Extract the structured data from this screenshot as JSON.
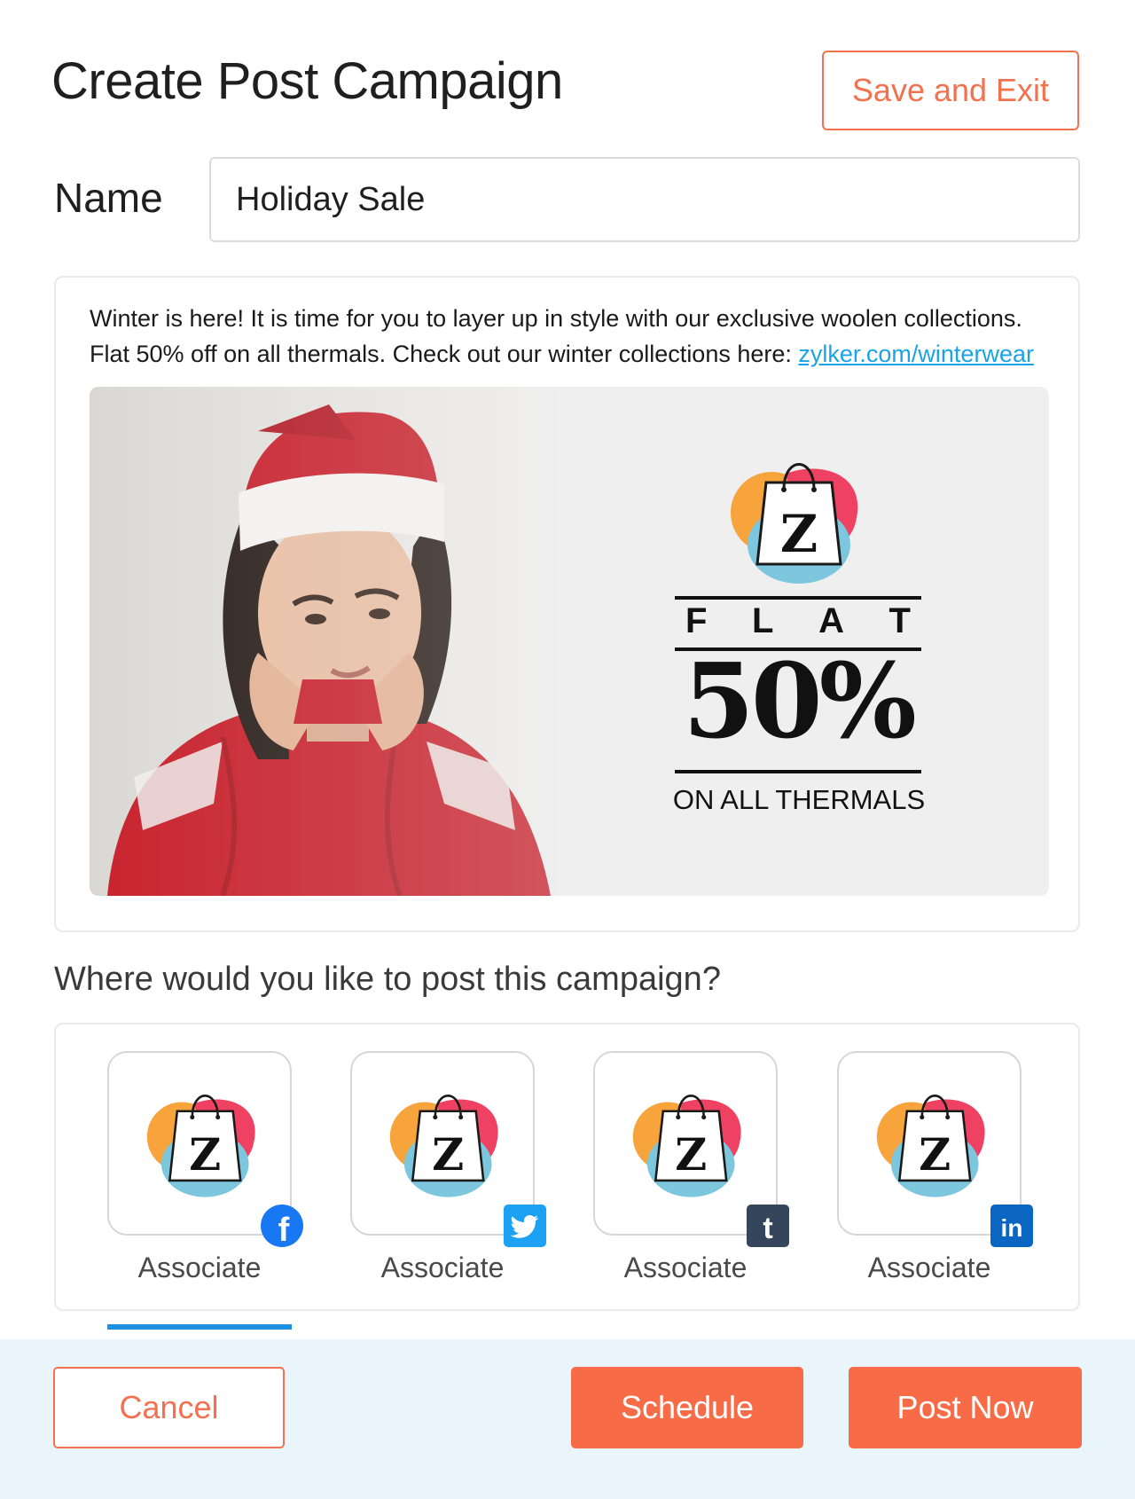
{
  "header": {
    "title": "Create Post Campaign",
    "save_exit_label": "Save and Exit"
  },
  "name_field": {
    "label": "Name",
    "value": "Holiday Sale"
  },
  "post": {
    "text": "Winter is here! It is time for you to layer up in style with our exclusive woolen collections. Flat 50% off on all thermals. Check out our winter collections here: ",
    "link_text": "zylker.com/winterwear",
    "banner": {
      "brand_letter": "Z",
      "flat_letters": [
        "F",
        "L",
        "A",
        "T"
      ],
      "discount": "50%",
      "subtitle": "ON ALL THERMALS"
    }
  },
  "channels_section": {
    "question": "Where would you like to post this campaign?",
    "channels": [
      {
        "network": "facebook",
        "badge_icon": "facebook-icon",
        "badge_text": "f",
        "label": "Associate",
        "selected": true
      },
      {
        "network": "twitter",
        "badge_icon": "twitter-icon",
        "badge_text": "",
        "label": "Associate",
        "selected": false
      },
      {
        "network": "tumblr",
        "badge_icon": "tumblr-icon",
        "badge_text": "t",
        "label": "Associate",
        "selected": false
      },
      {
        "network": "linkedin",
        "badge_icon": "linkedin-icon",
        "badge_text": "in",
        "label": "Associate",
        "selected": false
      }
    ]
  },
  "footer": {
    "cancel_label": "Cancel",
    "schedule_label": "Schedule",
    "post_now_label": "Post Now"
  },
  "colors": {
    "accent": "#f86b47",
    "link": "#1aa3e8",
    "facebook": "#1877f2",
    "twitter": "#1da1f2",
    "tumblr": "#35465c",
    "linkedin": "#0a66c2",
    "selected_underline": "#1b8fe0"
  }
}
